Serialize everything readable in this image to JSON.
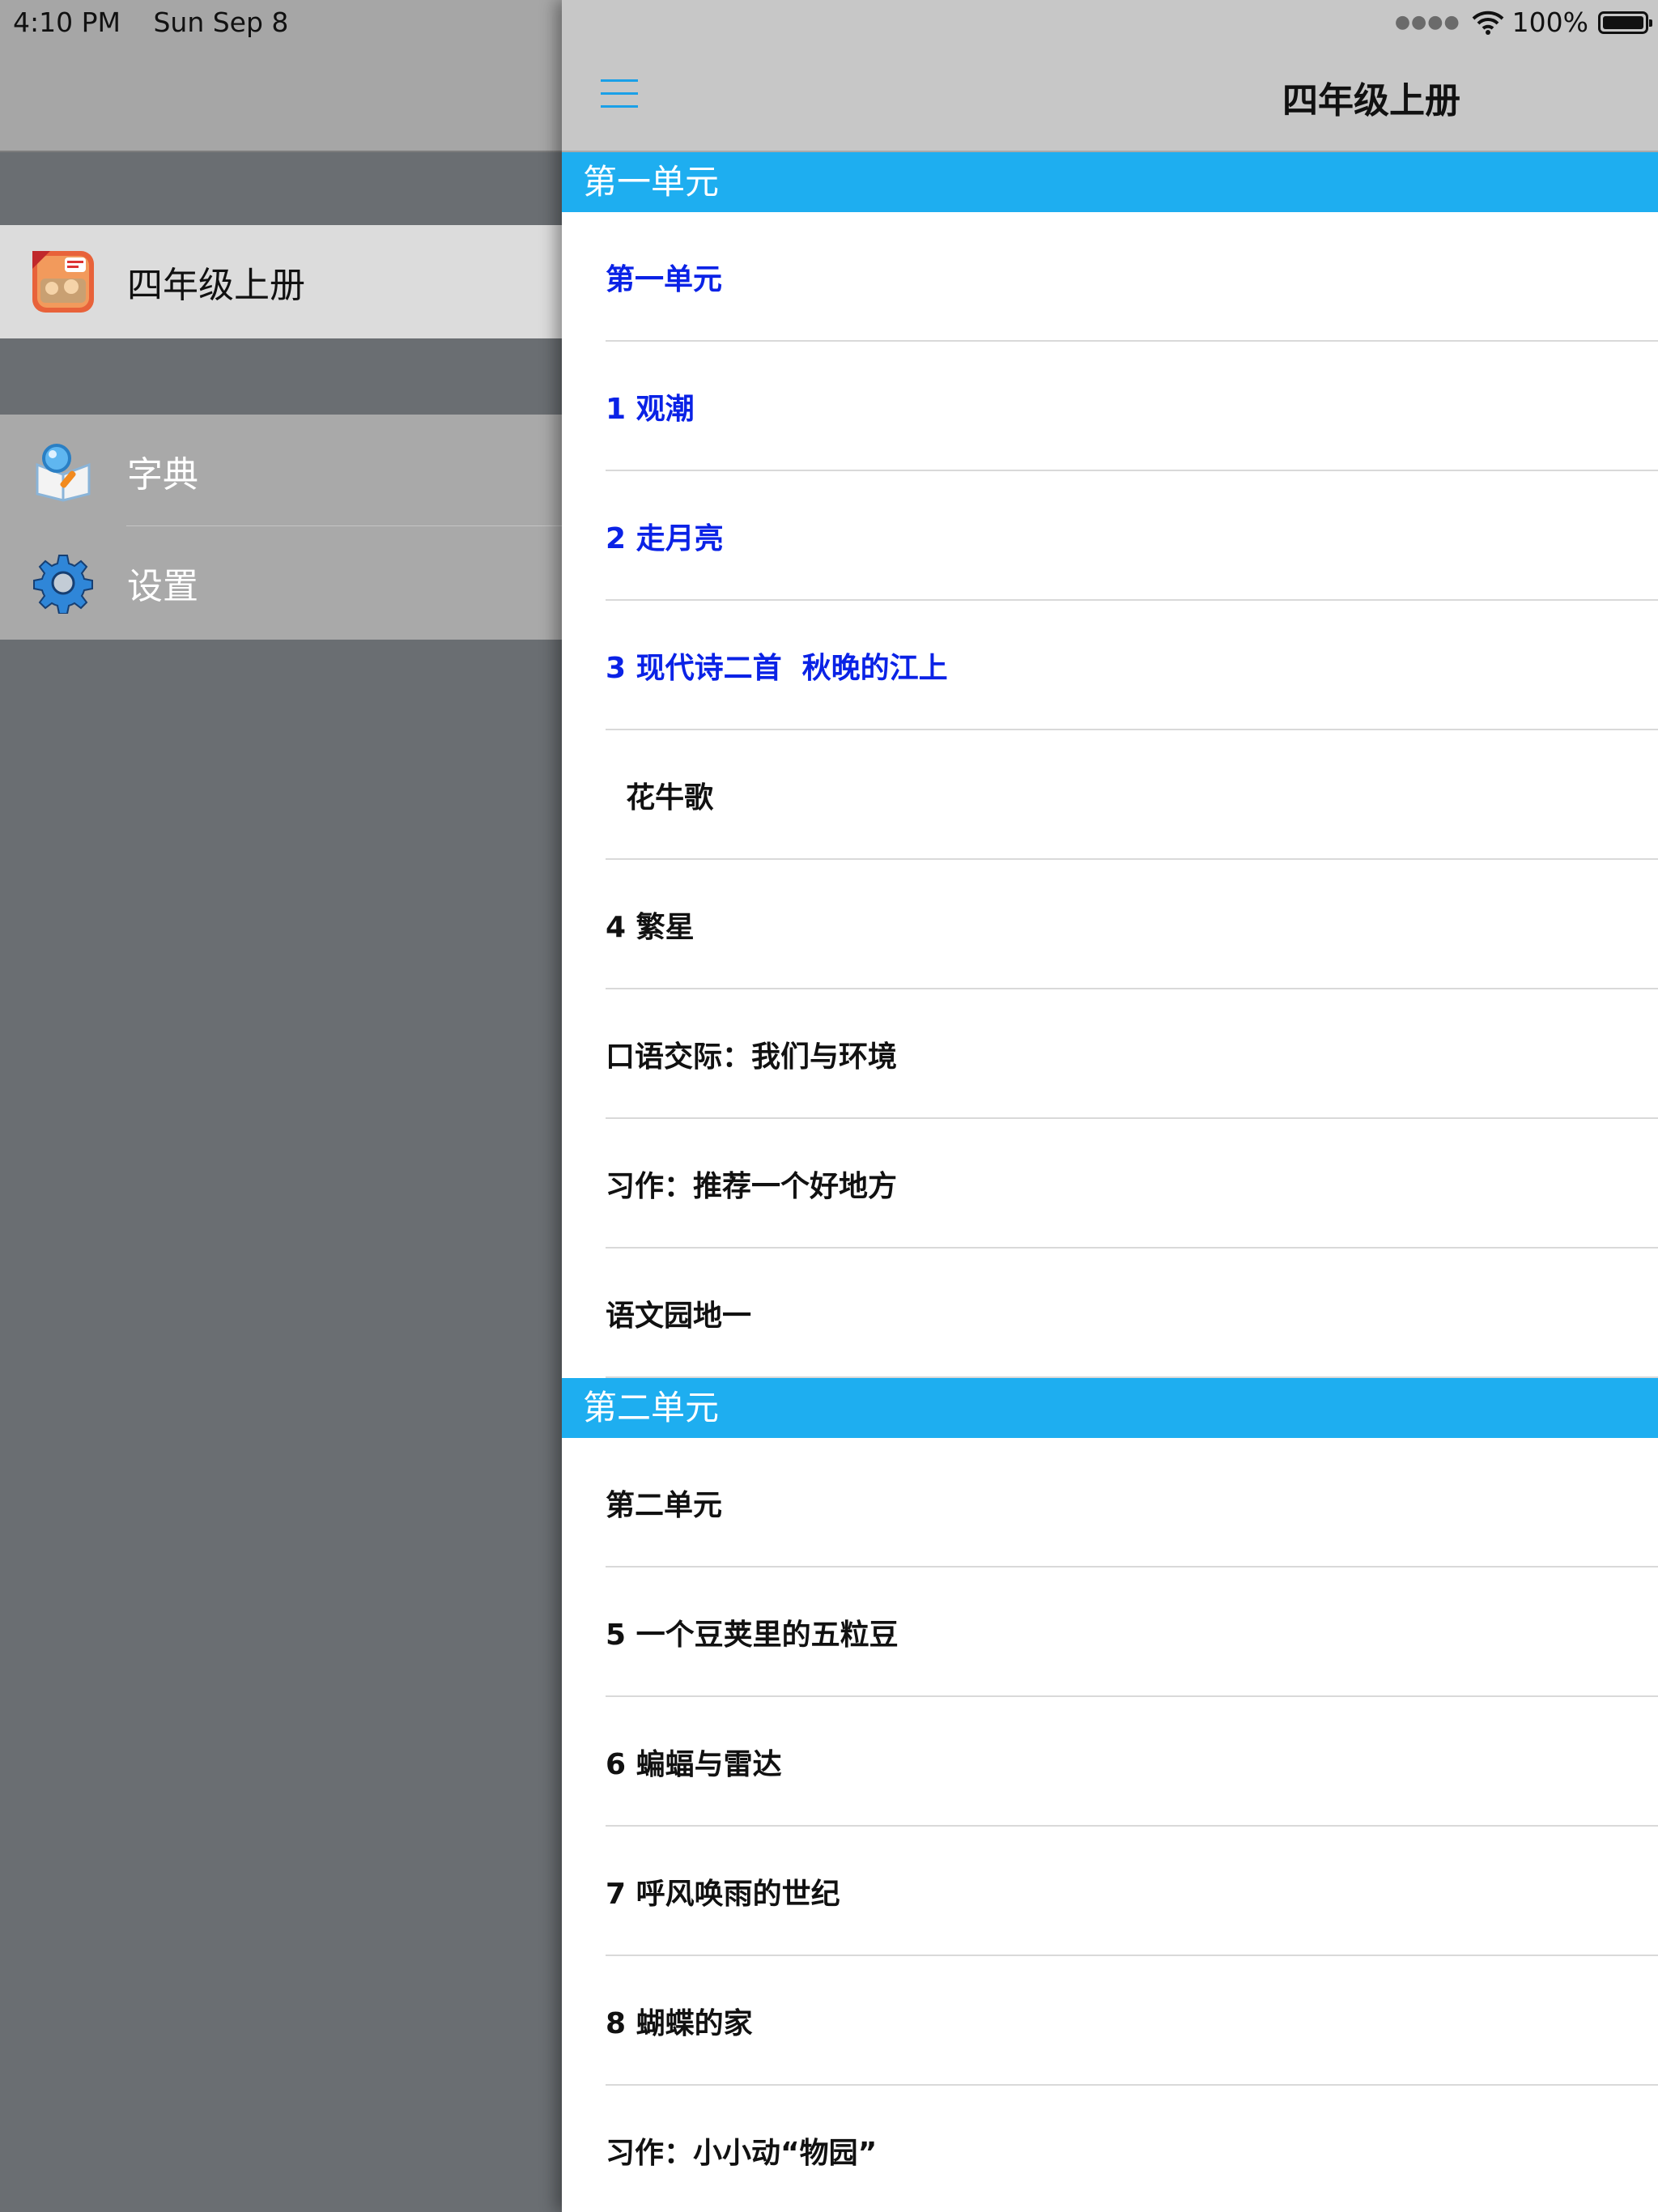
{
  "status_bar": {
    "time": "4:10 PM",
    "date": "Sun Sep 8",
    "battery_text": "100%",
    "battery_level": 1.0
  },
  "sidebar": {
    "items": [
      {
        "label": "四年级上册",
        "icon": "book-cover-icon",
        "selected": true
      },
      {
        "label": "字典",
        "icon": "dictionary-icon",
        "selected": false
      },
      {
        "label": "设置",
        "icon": "gear-icon",
        "selected": false
      }
    ]
  },
  "nav": {
    "title": "四年级上册",
    "menu_icon": "hamburger-menu-icon"
  },
  "sections": [
    {
      "title": "第一单元",
      "rows": [
        {
          "label": "第一单元",
          "highlighted": true
        },
        {
          "label": "1 观潮",
          "highlighted": true
        },
        {
          "label": "2 走月亮",
          "highlighted": true
        },
        {
          "label": "3 现代诗二首  秋晚的江上",
          "highlighted": true
        },
        {
          "label": "  花牛歌",
          "highlighted": false
        },
        {
          "label": "4 繁星",
          "highlighted": false
        },
        {
          "label": "口语交际：我们与环境",
          "highlighted": false
        },
        {
          "label": "习作：推荐一个好地方",
          "highlighted": false
        },
        {
          "label": "语文园地一",
          "highlighted": false
        }
      ]
    },
    {
      "title": "第二单元",
      "rows": [
        {
          "label": "第二单元",
          "highlighted": false
        },
        {
          "label": "5 一个豆荚里的五粒豆",
          "highlighted": false
        },
        {
          "label": "6 蝙蝠与雷达",
          "highlighted": false
        },
        {
          "label": "7 呼风唤雨的世纪",
          "highlighted": false
        },
        {
          "label": "8 蝴蝶的家",
          "highlighted": false
        },
        {
          "label": "习作：小小动“物园”",
          "highlighted": false
        }
      ]
    }
  ],
  "colors": {
    "section_header": "#1eaef0",
    "highlight_text": "#0a22e6",
    "accent": "#1aa0e8"
  }
}
